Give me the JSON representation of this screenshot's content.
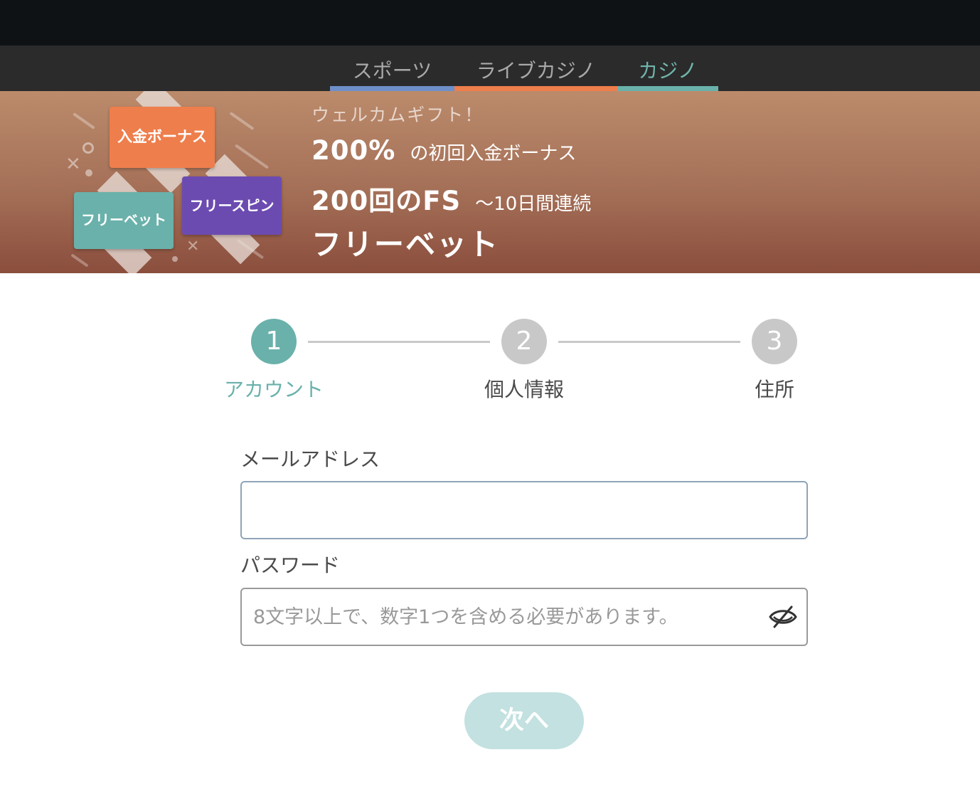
{
  "nav": {
    "tabs": [
      {
        "label": "スポーツ",
        "underline_color": "#6e8fc8"
      },
      {
        "label": "ライブカジノ",
        "underline_color": "#ee7e4c"
      },
      {
        "label": "カジノ",
        "underline_color": "#6ab1ab",
        "active": true
      }
    ]
  },
  "banner": {
    "cards": [
      "入金ボーナス",
      "フリーベット",
      "フリースピン"
    ],
    "welcome": "ウェルカムギフト！",
    "bonus_big": "200%",
    "bonus_small": "の初回入金ボーナス",
    "fs_big": "200回のFS",
    "fs_small": "〜10日間連続",
    "freebet": "フリーベット"
  },
  "stepper": {
    "steps": [
      {
        "number": "1",
        "label": "アカウント",
        "active": true
      },
      {
        "number": "2",
        "label": "個人情報",
        "active": false
      },
      {
        "number": "3",
        "label": "住所",
        "active": false
      }
    ],
    "active_color": "#6ab1ab",
    "inactive_color": "#c8c8c8"
  },
  "form": {
    "email_label": "メールアドレス",
    "email_value": "",
    "password_label": "パスワード",
    "password_placeholder": "8文字以上で、数字1つを含める必要があります。",
    "password_value": "",
    "password_visibility_icon": "eye-slash-icon",
    "next_button": "次へ"
  }
}
